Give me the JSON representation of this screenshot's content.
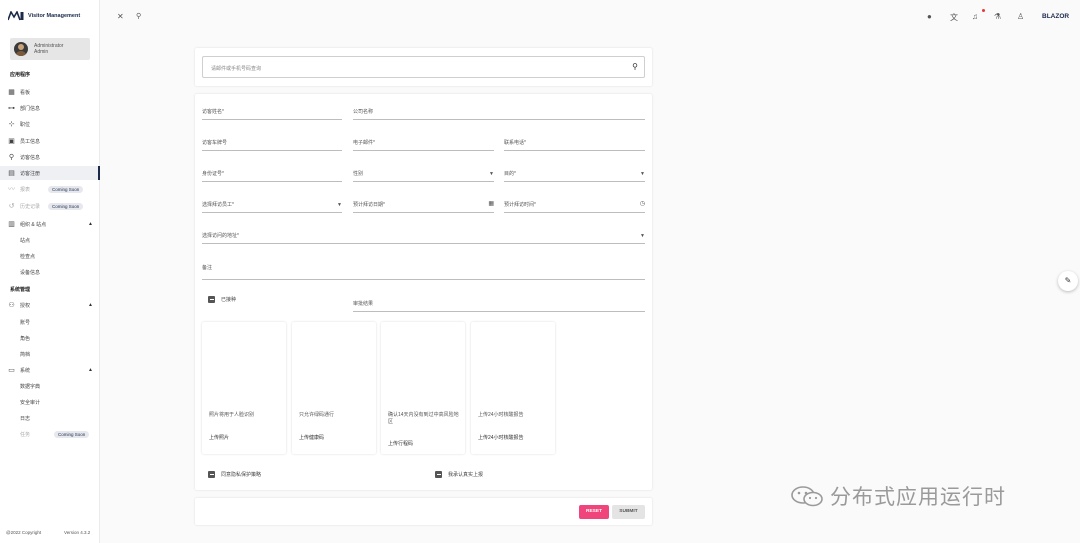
{
  "brand": {
    "title": "Visitor Management"
  },
  "user": {
    "line1": "Administrator",
    "line2": "Admin"
  },
  "nav": {
    "section_app": "应用程序",
    "dashboard": "看板",
    "departments": "部门信息",
    "positions": "职位",
    "employees": "员工信息",
    "visitors": "访客信息",
    "visitor_register": "访客注册",
    "reports": "报表",
    "history": "历史记录",
    "coming_soon": "Coming Soon",
    "org_sites": "组织 & 站点",
    "sites": "站点",
    "checkpoints": "检查点",
    "devices": "设备信息",
    "section_sys": "系统管理",
    "auth": "授权",
    "accounts": "账号",
    "roles": "角色",
    "profile": "简档",
    "system": "系统",
    "dictionary": "数据字典",
    "audit": "安全审计",
    "logs": "日志",
    "tasks": "任务"
  },
  "footer": {
    "copyright": "@2022 Copyright",
    "version": "Version 4.3.2"
  },
  "topbar": {
    "brand_right": "BLAZOR"
  },
  "search": {
    "placeholder": "请邮件或手机号码查询"
  },
  "form": {
    "visitor_name": "访客姓名*",
    "company": "公司名称",
    "plate": "访客车牌号",
    "email": "电子邮件*",
    "phone": "联系电话*",
    "id_no": "身份证号*",
    "gender": "性别",
    "purpose": "目的*",
    "employee": "选择拜访员工*",
    "visit_date": "预计拜访日期*",
    "visit_time": "预计拜访时间*",
    "visit_site": "选择访问的地址*",
    "remark": "备注",
    "vaccinated": "已接种",
    "review_result": "审批结果",
    "privacy": "同意隐私保护策略",
    "confirm": "我承认真实上报"
  },
  "uploads": [
    {
      "desc": "照片将用于人脸识别",
      "button": "上传照片"
    },
    {
      "desc": "只允许绿码通行",
      "button": "上传健康码"
    },
    {
      "desc": "确认14天内没有到过中高风险地区",
      "button": "上传行程码"
    },
    {
      "desc": "上传24小时核酸报告",
      "button": "上传24小时核酸报告"
    }
  ],
  "buttons": {
    "reset": "RESET",
    "submit": "SUBMIT"
  },
  "watermark": {
    "text": "分布式应用运行时"
  }
}
